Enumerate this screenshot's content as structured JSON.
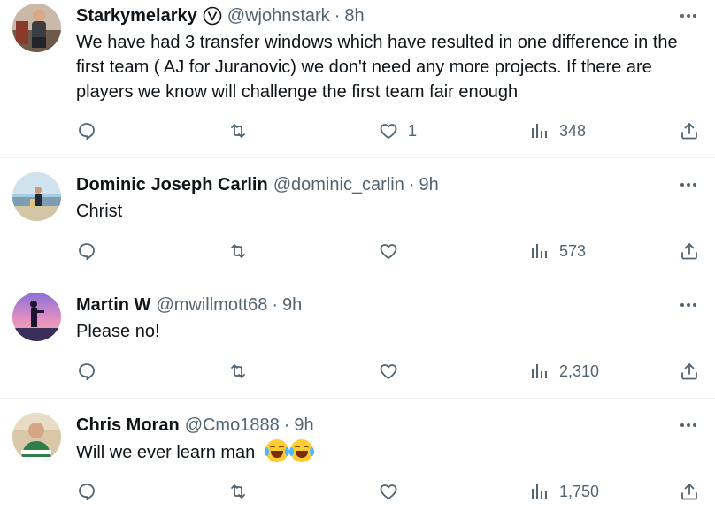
{
  "tweets": [
    {
      "name": "Starkymelarky",
      "handle": "@wjohnstark",
      "sep": "·",
      "time": "8h",
      "text": "We have had 3 transfer windows which have resulted in one difference in the first team ( AJ for Juranovic) we don't need any more projects. If there are players we know will challenge the first team fair enough",
      "likes": "1",
      "views": "348"
    },
    {
      "name": "Dominic Joseph Carlin",
      "handle": "@dominic_carlin",
      "sep": "·",
      "time": "9h",
      "text": "Christ",
      "likes": "",
      "views": "573"
    },
    {
      "name": "Martin W",
      "handle": "@mwillmott68",
      "sep": "·",
      "time": "9h",
      "text": "Please no!",
      "likes": "",
      "views": "2,310"
    },
    {
      "name": "Chris Moran",
      "handle": "@Cmo1888",
      "sep": "·",
      "time": "9h",
      "text": "Will we ever learn man",
      "emoji": "😂😂",
      "likes": "",
      "views": "1,750"
    }
  ],
  "icons": {
    "more": "more-horizontal-icon",
    "reply": "reply-icon",
    "retweet": "retweet-icon",
    "like": "heart-icon",
    "views": "views-icon",
    "share": "share-icon",
    "verified": "verified-badge-icon"
  },
  "colors": {
    "text": "#0f1419",
    "secondary": "#536471",
    "divider": "#eff3f4"
  }
}
